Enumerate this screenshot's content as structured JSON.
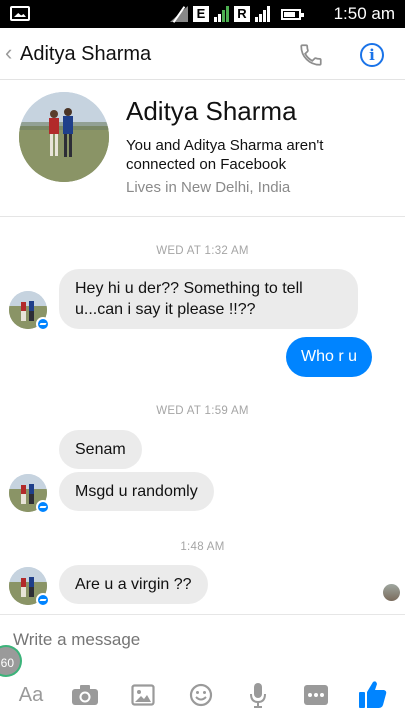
{
  "status_bar": {
    "network_e": "E",
    "network_r": "R",
    "time": "1:50 am"
  },
  "header": {
    "back_glyph": "‹",
    "title": "Aditya Sharma",
    "call_icon": "phone-icon",
    "info_icon": "info-icon",
    "info_glyph": "i",
    "accent": "#1a73e8"
  },
  "profile": {
    "name": "Aditya Sharma",
    "connection_text": "You and Aditya Sharma aren't connected on Facebook",
    "location": "Lives in New Delhi, India"
  },
  "messages": [
    {
      "type": "timestamp",
      "text": "WED AT 1:32 AM"
    },
    {
      "type": "incoming",
      "text": "Hey hi u der?? Something to tell u...can i say it please !!??"
    },
    {
      "type": "outgoing",
      "text": "Who r u"
    },
    {
      "type": "timestamp",
      "text": "WED AT 1:59 AM"
    },
    {
      "type": "incoming",
      "text": "Senam"
    },
    {
      "type": "incoming",
      "text": "Msgd u randomly"
    },
    {
      "type": "timestamp",
      "text": "1:48 AM"
    },
    {
      "type": "incoming",
      "text": "Are u a virgin ??"
    }
  ],
  "composer": {
    "placeholder": "Write a message",
    "counter": "60",
    "text_button": "Aa",
    "tools": [
      "camera-icon",
      "gallery-icon",
      "emoji-icon",
      "microphone-icon",
      "more-icon",
      "like-icon"
    ],
    "like_color": "#0084ff"
  },
  "colors": {
    "outgoing_bubble": "#0084ff",
    "incoming_bubble": "#ebebeb",
    "timestamp": "#a5a5a5"
  }
}
